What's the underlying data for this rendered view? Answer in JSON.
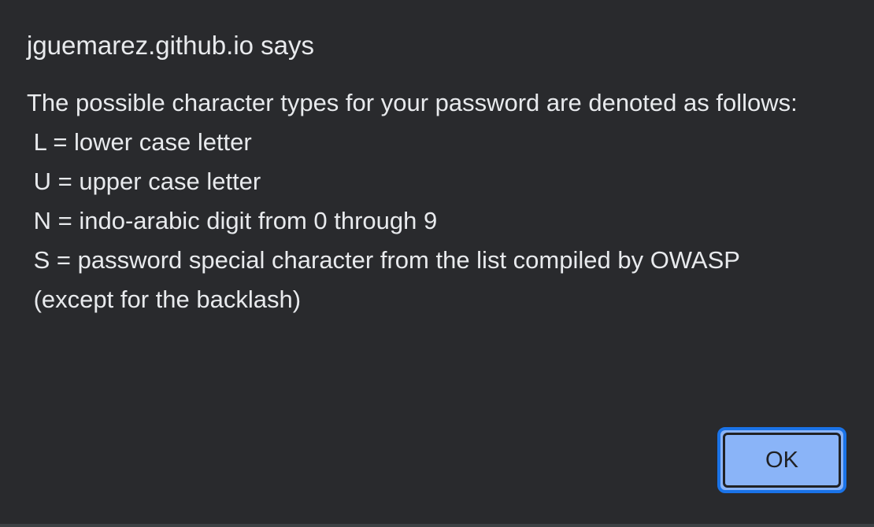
{
  "dialog": {
    "title": "jguemarez.github.io says",
    "message_lines": [
      "The possible character types for your password are denoted as follows:",
      " L = lower case letter",
      " U = upper case letter",
      " N = indo-arabic digit from 0 through 9",
      " S = password special character from the list compiled by OWASP",
      " (except for the backlash)"
    ],
    "ok_label": "OK"
  },
  "colors": {
    "background": "#292a2d",
    "text": "#e8eaed",
    "button_fill": "#8ab4f8",
    "button_focus_ring": "#1a73e8",
    "button_text": "#202124"
  }
}
